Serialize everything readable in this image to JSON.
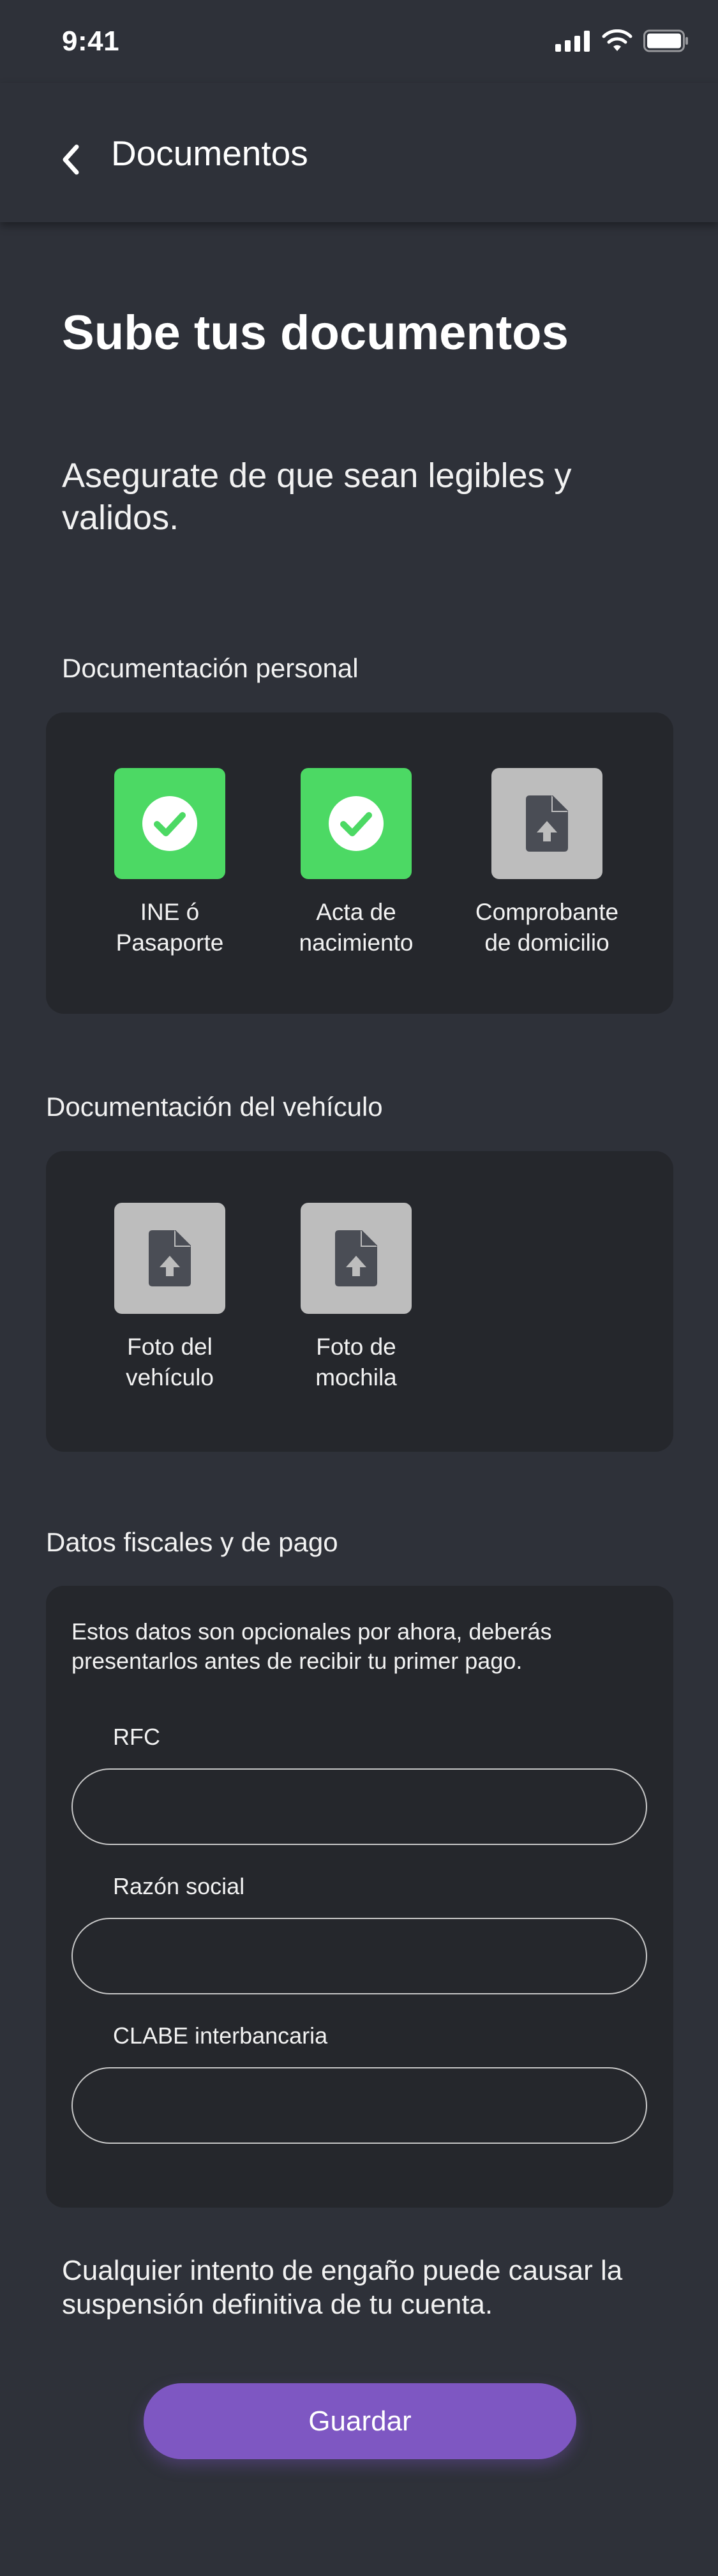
{
  "status_bar": {
    "time": "9:41"
  },
  "nav": {
    "title": "Documentos"
  },
  "header": {
    "title": "Sube tus documentos",
    "subtitle": "Asegurate de que sean legibles y validos."
  },
  "personal_docs": {
    "title": "Documentación personal",
    "items": [
      {
        "line1": "INE ó",
        "line2": "Pasaporte",
        "status": "uploaded",
        "icon": "check-icon"
      },
      {
        "line1": "Acta de",
        "line2": "nacimiento",
        "status": "uploaded",
        "icon": "check-icon"
      },
      {
        "line1": "Comprobante",
        "line2": "de domicilio",
        "status": "pending",
        "icon": "file-upload-icon"
      }
    ]
  },
  "vehicle_docs": {
    "title": "Documentación del vehículo",
    "items": [
      {
        "line1": "Foto del",
        "line2": "vehículo",
        "status": "pending",
        "icon": "file-upload-icon"
      },
      {
        "line1": "Foto de",
        "line2": "mochila",
        "status": "pending",
        "icon": "file-upload-icon"
      }
    ]
  },
  "fiscal": {
    "title": "Datos fiscales y de pago",
    "note": "Estos datos son opcionales por ahora, deberás presentarlos antes de recibir tu primer pago.",
    "fields": [
      {
        "label": "RFC",
        "value": "",
        "placeholder": ""
      },
      {
        "label": "Razón social",
        "value": "",
        "placeholder": ""
      },
      {
        "label": "CLABE interbancaria",
        "value": "",
        "placeholder": ""
      }
    ]
  },
  "warning": "Cualquier intento de engaño puede causar la suspensión definitiva de tu cuenta.",
  "actions": {
    "save_label": "Guardar"
  },
  "colors": {
    "background": "#2E3139",
    "card": "#25272C",
    "success": "#4CD964",
    "pending": "#BDBDBD",
    "accent": "#7E57C2"
  }
}
